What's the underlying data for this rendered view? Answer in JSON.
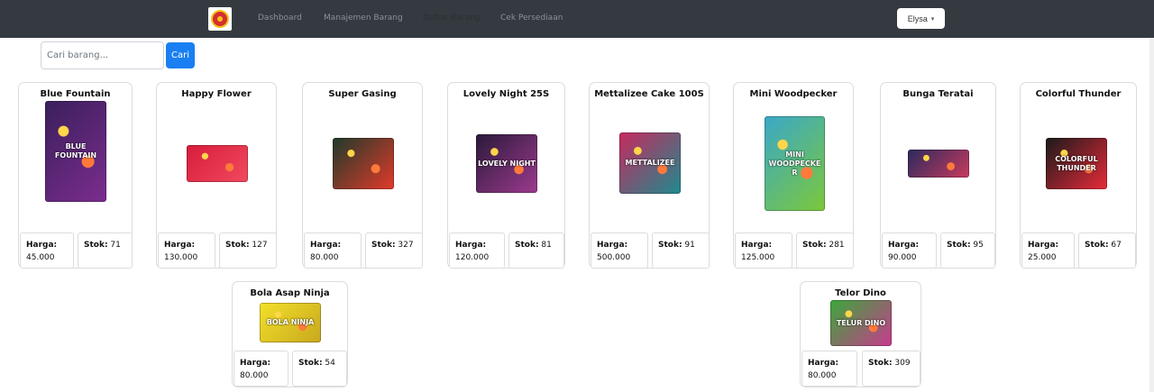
{
  "nav": {
    "items": [
      "Dashboard",
      "Manajemen Barang",
      "Daftar Barang",
      "Cek Persediaan"
    ],
    "active": "Daftar Barang",
    "user": "Elysa"
  },
  "search": {
    "placeholder": "Cari barang...",
    "button": "Cari"
  },
  "labels": {
    "harga": "Harga:",
    "stok": "Stok:"
  },
  "products": [
    {
      "name": "Blue Fountain",
      "harga": "45.000",
      "stok": "71",
      "image_text": "BLUE FOUNTAIN",
      "colors": [
        "#3a1f5c",
        "#7b2d8e"
      ]
    },
    {
      "name": "Happy Flower",
      "harga": "130.000",
      "stok": "127",
      "image_text": "",
      "colors": [
        "#d81c3c",
        "#f04a5e"
      ]
    },
    {
      "name": "Super Gasing",
      "harga": "80.000",
      "stok": "327",
      "image_text": "",
      "colors": [
        "#1e3a2a",
        "#e23a2a"
      ]
    },
    {
      "name": "Lovely Night 25S",
      "harga": "120.000",
      "stok": "81",
      "image_text": "LOVELY NIGHT",
      "colors": [
        "#2a1a3a",
        "#9c3a8e"
      ]
    },
    {
      "name": "Mettalizee Cake 100S",
      "harga": "500.000",
      "stok": "91",
      "image_text": "METTALIZEE",
      "colors": [
        "#c62a5e",
        "#1e8a8e"
      ]
    },
    {
      "name": "Mini Woodpecker",
      "harga": "125.000",
      "stok": "281",
      "image_text": "MINI WOODPECKER",
      "colors": [
        "#3aa8c8",
        "#7cc83a"
      ]
    },
    {
      "name": "Bunga Teratai",
      "harga": "90.000",
      "stok": "95",
      "image_text": "",
      "colors": [
        "#2a2a5e",
        "#c83a5e"
      ]
    },
    {
      "name": "Colorful Thunder",
      "harga": "25.000",
      "stok": "67",
      "image_text": "COLORFUL THUNDER",
      "colors": [
        "#1a1a1a",
        "#e82a3a"
      ]
    },
    {
      "name": "Bola Asap Ninja",
      "harga": "80.000",
      "stok": "54",
      "image_text": "BOLA NINJA",
      "colors": [
        "#f2e02a",
        "#c8a81e"
      ]
    },
    {
      "name": "Telor Dino",
      "harga": "80.000",
      "stok": "309",
      "image_text": "TELUR DINO",
      "colors": [
        "#3aa83a",
        "#c83a8e"
      ]
    }
  ]
}
